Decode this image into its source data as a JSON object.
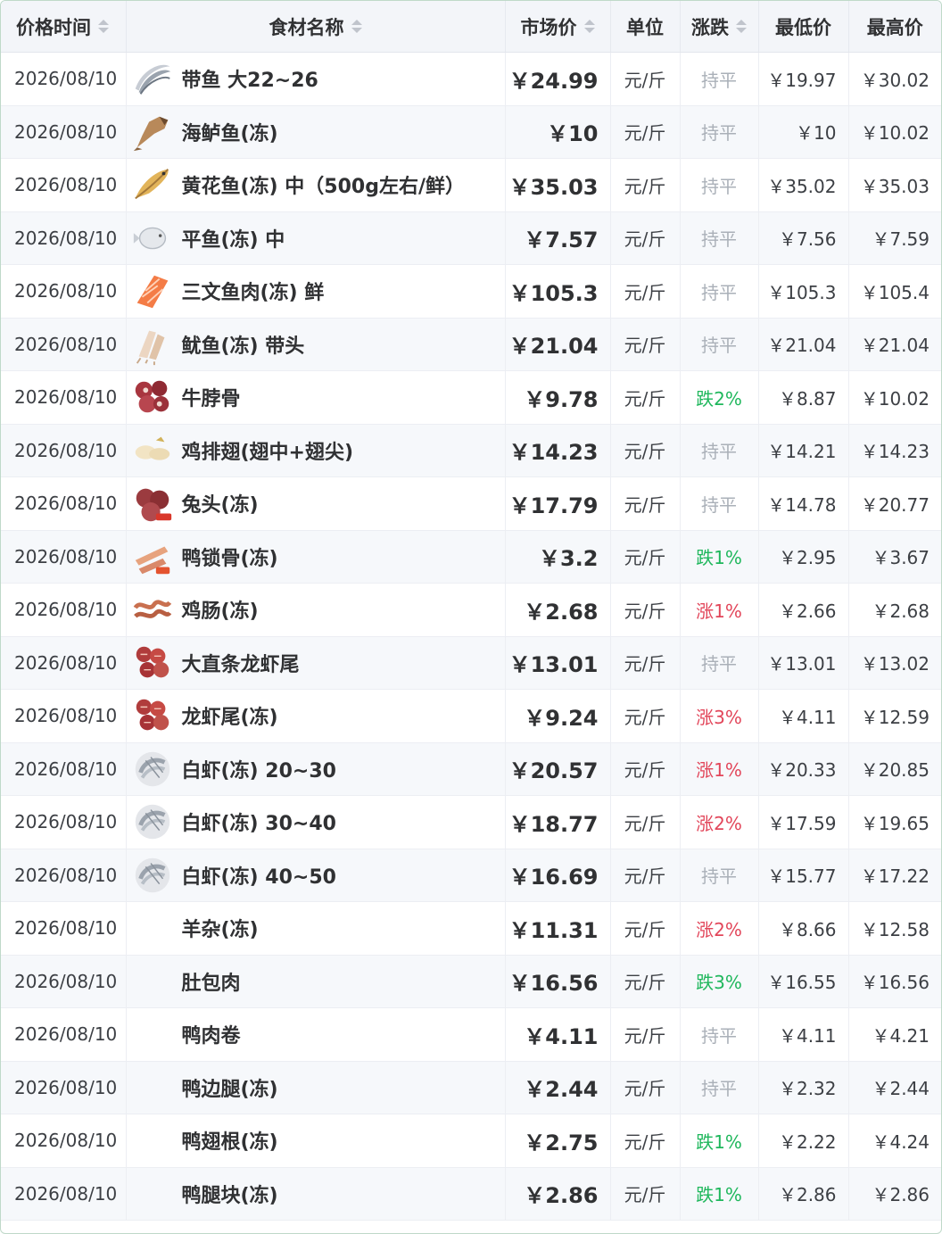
{
  "header": {
    "date": "价格时间",
    "name": "食材名称",
    "price": "市场价",
    "unit": "单位",
    "change": "涨跌",
    "low": "最低价",
    "high": "最高价"
  },
  "colors": {
    "flat": "#aab0b8",
    "down": "#1fb75c",
    "up": "#e2465a"
  },
  "rows": [
    {
      "date": "2026/08/10",
      "name": "带鱼 大22~26",
      "price": "￥24.99",
      "unit": "元/斤",
      "change": "持平",
      "trend": "flat",
      "low": "￥19.97",
      "high": "￥30.02",
      "icon": "hairtail-fish-icon"
    },
    {
      "date": "2026/08/10",
      "name": "海鲈鱼(冻)",
      "price": "￥10",
      "unit": "元/斤",
      "change": "持平",
      "trend": "flat",
      "low": "￥10",
      "high": "￥10.02",
      "icon": "sea-bass-icon"
    },
    {
      "date": "2026/08/10",
      "name": "黄花鱼(冻) 中（500g左右/鲜）",
      "price": "￥35.03",
      "unit": "元/斤",
      "change": "持平",
      "trend": "flat",
      "low": "￥35.02",
      "high": "￥35.03",
      "icon": "yellow-croaker-icon"
    },
    {
      "date": "2026/08/10",
      "name": "平鱼(冻) 中",
      "price": "￥7.57",
      "unit": "元/斤",
      "change": "持平",
      "trend": "flat",
      "low": "￥7.56",
      "high": "￥7.59",
      "icon": "pomfret-icon"
    },
    {
      "date": "2026/08/10",
      "name": "三文鱼肉(冻) 鲜",
      "price": "￥105.3",
      "unit": "元/斤",
      "change": "持平",
      "trend": "flat",
      "low": "￥105.3",
      "high": "￥105.4",
      "icon": "salmon-fillet-icon"
    },
    {
      "date": "2026/08/10",
      "name": "鱿鱼(冻) 带头",
      "price": "￥21.04",
      "unit": "元/斤",
      "change": "持平",
      "trend": "flat",
      "low": "￥21.04",
      "high": "￥21.04",
      "icon": "squid-icon"
    },
    {
      "date": "2026/08/10",
      "name": "牛脖骨",
      "price": "￥9.78",
      "unit": "元/斤",
      "change": "跌2%",
      "trend": "down",
      "low": "￥8.87",
      "high": "￥10.02",
      "icon": "beef-neck-bone-icon"
    },
    {
      "date": "2026/08/10",
      "name": "鸡排翅(翅中+翅尖)",
      "price": "￥14.23",
      "unit": "元/斤",
      "change": "持平",
      "trend": "flat",
      "low": "￥14.21",
      "high": "￥14.23",
      "icon": "chicken-wing-icon"
    },
    {
      "date": "2026/08/10",
      "name": "兔头(冻)",
      "price": "￥17.79",
      "unit": "元/斤",
      "change": "持平",
      "trend": "flat",
      "low": "￥14.78",
      "high": "￥20.77",
      "icon": "rabbit-head-icon"
    },
    {
      "date": "2026/08/10",
      "name": "鸭锁骨(冻)",
      "price": "￥3.2",
      "unit": "元/斤",
      "change": "跌1%",
      "trend": "down",
      "low": "￥2.95",
      "high": "￥3.67",
      "icon": "duck-bone-icon"
    },
    {
      "date": "2026/08/10",
      "name": "鸡肠(冻)",
      "price": "￥2.68",
      "unit": "元/斤",
      "change": "涨1%",
      "trend": "up",
      "low": "￥2.66",
      "high": "￥2.68",
      "icon": "chicken-intestine-icon"
    },
    {
      "date": "2026/08/10",
      "name": "大直条龙虾尾",
      "price": "￥13.01",
      "unit": "元/斤",
      "change": "持平",
      "trend": "flat",
      "low": "￥13.01",
      "high": "￥13.02",
      "icon": "crayfish-tail-icon"
    },
    {
      "date": "2026/08/10",
      "name": "龙虾尾(冻)",
      "price": "￥9.24",
      "unit": "元/斤",
      "change": "涨3%",
      "trend": "up",
      "low": "￥4.11",
      "high": "￥12.59",
      "icon": "crayfish-tail-icon"
    },
    {
      "date": "2026/08/10",
      "name": "白虾(冻) 20~30",
      "price": "￥20.57",
      "unit": "元/斤",
      "change": "涨1%",
      "trend": "up",
      "low": "￥20.33",
      "high": "￥20.85",
      "icon": "white-shrimp-icon"
    },
    {
      "date": "2026/08/10",
      "name": "白虾(冻) 30~40",
      "price": "￥18.77",
      "unit": "元/斤",
      "change": "涨2%",
      "trend": "up",
      "low": "￥17.59",
      "high": "￥19.65",
      "icon": "white-shrimp-icon"
    },
    {
      "date": "2026/08/10",
      "name": "白虾(冻) 40~50",
      "price": "￥16.69",
      "unit": "元/斤",
      "change": "持平",
      "trend": "flat",
      "low": "￥15.77",
      "high": "￥17.22",
      "icon": "white-shrimp-icon"
    },
    {
      "date": "2026/08/10",
      "name": "羊杂(冻)",
      "price": "￥11.31",
      "unit": "元/斤",
      "change": "涨2%",
      "trend": "up",
      "low": "￥8.66",
      "high": "￥12.58",
      "icon": ""
    },
    {
      "date": "2026/08/10",
      "name": "肚包肉",
      "price": "￥16.56",
      "unit": "元/斤",
      "change": "跌3%",
      "trend": "down",
      "low": "￥16.55",
      "high": "￥16.56",
      "icon": ""
    },
    {
      "date": "2026/08/10",
      "name": "鸭肉卷",
      "price": "￥4.11",
      "unit": "元/斤",
      "change": "持平",
      "trend": "flat",
      "low": "￥4.11",
      "high": "￥4.21",
      "icon": ""
    },
    {
      "date": "2026/08/10",
      "name": "鸭边腿(冻)",
      "price": "￥2.44",
      "unit": "元/斤",
      "change": "持平",
      "trend": "flat",
      "low": "￥2.32",
      "high": "￥2.44",
      "icon": ""
    },
    {
      "date": "2026/08/10",
      "name": "鸭翅根(冻)",
      "price": "￥2.75",
      "unit": "元/斤",
      "change": "跌1%",
      "trend": "down",
      "low": "￥2.22",
      "high": "￥4.24",
      "icon": ""
    },
    {
      "date": "2026/08/10",
      "name": "鸭腿块(冻)",
      "price": "￥2.86",
      "unit": "元/斤",
      "change": "跌1%",
      "trend": "down",
      "low": "￥2.86",
      "high": "￥2.86",
      "icon": ""
    }
  ]
}
